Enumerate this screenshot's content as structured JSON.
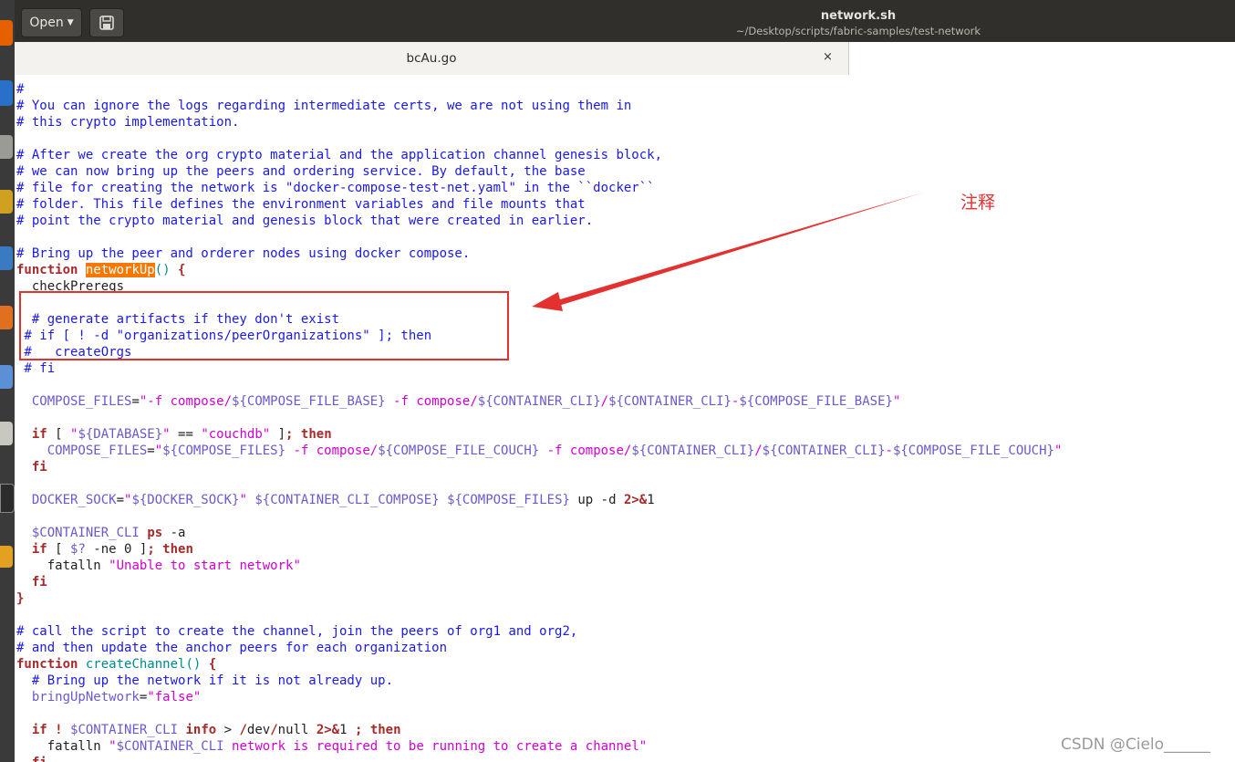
{
  "window": {
    "open_label": "Open",
    "title": "network.sh",
    "subtitle": "~/Desktop/scripts/fabric-samples/test-network"
  },
  "tab": {
    "label": "bcAu.go",
    "close": "×"
  },
  "colors": {
    "comment": "#1a1ae5",
    "keyword": "#a52a2a",
    "function_name": "#008a8c",
    "string": "#d000d0",
    "variable": "#6a5acd",
    "highlight": "#f57900",
    "annotation": "#e53030"
  },
  "code_lines": [
    [
      [
        "cm",
        "#"
      ]
    ],
    [
      [
        "cm",
        "# You can ignore the logs regarding intermediate certs, we are not using them in"
      ]
    ],
    [
      [
        "cm",
        "# this crypto implementation."
      ]
    ],
    [],
    [
      [
        "cm",
        "# After we create the org crypto material and the application channel genesis block,"
      ]
    ],
    [
      [
        "cm",
        "# we can now bring up the peers and ordering service. By default, the base"
      ]
    ],
    [
      [
        "cm",
        "# file for creating the network is \"docker-compose-test-net.yaml\" in the ``docker``"
      ]
    ],
    [
      [
        "cm",
        "# folder. This file defines the environment variables and file mounts that"
      ]
    ],
    [
      [
        "cm",
        "# point the crypto material and genesis block that were created in earlier."
      ]
    ],
    [],
    [
      [
        "cm",
        "# Bring up the peer and orderer nodes using docker compose."
      ]
    ],
    [
      [
        "kw",
        "function"
      ],
      [
        "pl",
        " "
      ],
      [
        "hl",
        "networkUp"
      ],
      [
        "fn",
        "()"
      ],
      [
        "pl",
        " "
      ],
      [
        "kw",
        "{"
      ]
    ],
    [
      [
        "pl",
        "  checkPrereqs"
      ]
    ],
    [],
    [
      [
        "cm",
        "  # generate artifacts if they don't exist"
      ]
    ],
    [
      [
        "cm",
        " # if [ ! -d \"organizations/peerOrganizations\" ]; then"
      ]
    ],
    [
      [
        "cm",
        " #   createOrgs"
      ]
    ],
    [
      [
        "cm",
        " # fi"
      ]
    ],
    [],
    [
      [
        "pl",
        "  "
      ],
      [
        "vr",
        "COMPOSE_FILES"
      ],
      [
        "pl",
        "="
      ],
      [
        "st",
        "\"-f compose/"
      ],
      [
        "vr",
        "${COMPOSE_FILE_BASE}"
      ],
      [
        "st",
        " -f compose/"
      ],
      [
        "vr",
        "${CONTAINER_CLI}"
      ],
      [
        "st",
        "/"
      ],
      [
        "vr",
        "${CONTAINER_CLI}"
      ],
      [
        "st",
        "-"
      ],
      [
        "vr",
        "${COMPOSE_FILE_BASE}"
      ],
      [
        "st",
        "\""
      ]
    ],
    [],
    [
      [
        "pl",
        "  "
      ],
      [
        "kw",
        "if"
      ],
      [
        "pl",
        " [ "
      ],
      [
        "st",
        "\""
      ],
      [
        "vr",
        "${DATABASE}"
      ],
      [
        "st",
        "\""
      ],
      [
        "pl",
        " == "
      ],
      [
        "st",
        "\"couchdb\""
      ],
      [
        "pl",
        " ]"
      ],
      [
        "kw",
        "; then"
      ]
    ],
    [
      [
        "pl",
        "    "
      ],
      [
        "vr",
        "COMPOSE_FILES"
      ],
      [
        "pl",
        "="
      ],
      [
        "st",
        "\""
      ],
      [
        "vr",
        "${COMPOSE_FILES}"
      ],
      [
        "st",
        " -f compose/"
      ],
      [
        "vr",
        "${COMPOSE_FILE_COUCH}"
      ],
      [
        "st",
        " -f compose/"
      ],
      [
        "vr",
        "${CONTAINER_CLI}"
      ],
      [
        "st",
        "/"
      ],
      [
        "vr",
        "${CONTAINER_CLI}"
      ],
      [
        "st",
        "-"
      ],
      [
        "vr",
        "${COMPOSE_FILE_COUCH}"
      ],
      [
        "st",
        "\""
      ]
    ],
    [
      [
        "pl",
        "  "
      ],
      [
        "kw",
        "fi"
      ]
    ],
    [],
    [
      [
        "pl",
        "  "
      ],
      [
        "vr",
        "DOCKER_SOCK"
      ],
      [
        "pl",
        "="
      ],
      [
        "st",
        "\""
      ],
      [
        "vr",
        "${DOCKER_SOCK}"
      ],
      [
        "st",
        "\""
      ],
      [
        "pl",
        " "
      ],
      [
        "vr",
        "${CONTAINER_CLI_COMPOSE}"
      ],
      [
        "pl",
        " "
      ],
      [
        "vr",
        "${COMPOSE_FILES}"
      ],
      [
        "pl",
        " up -d "
      ],
      [
        "kw",
        "2>&"
      ],
      [
        "pl",
        "1"
      ]
    ],
    [],
    [
      [
        "pl",
        "  "
      ],
      [
        "vr",
        "$CONTAINER_CLI"
      ],
      [
        "pl",
        " "
      ],
      [
        "kw",
        "ps"
      ],
      [
        "pl",
        " -a"
      ]
    ],
    [
      [
        "pl",
        "  "
      ],
      [
        "kw",
        "if"
      ],
      [
        "pl",
        " [ "
      ],
      [
        "vr",
        "$?"
      ],
      [
        "pl",
        " -ne 0 ]"
      ],
      [
        "kw",
        "; then"
      ]
    ],
    [
      [
        "pl",
        "    fatalln "
      ],
      [
        "st",
        "\"Unable to start network\""
      ]
    ],
    [
      [
        "pl",
        "  "
      ],
      [
        "kw",
        "fi"
      ]
    ],
    [
      [
        "kw",
        "}"
      ]
    ],
    [],
    [
      [
        "cm",
        "# call the script to create the channel, join the peers of org1 and org2,"
      ]
    ],
    [
      [
        "cm",
        "# and then update the anchor peers for each organization"
      ]
    ],
    [
      [
        "kw",
        "function"
      ],
      [
        "pl",
        " "
      ],
      [
        "fn",
        "createChannel()"
      ],
      [
        "pl",
        " "
      ],
      [
        "kw",
        "{"
      ]
    ],
    [
      [
        "cm",
        "  # Bring up the network if it is not already up."
      ]
    ],
    [
      [
        "pl",
        "  "
      ],
      [
        "vr",
        "bringUpNetwork"
      ],
      [
        "pl",
        "="
      ],
      [
        "st",
        "\"false\""
      ]
    ],
    [],
    [
      [
        "pl",
        "  "
      ],
      [
        "kw",
        "if !"
      ],
      [
        "pl",
        " "
      ],
      [
        "vr",
        "$CONTAINER_CLI"
      ],
      [
        "pl",
        " "
      ],
      [
        "kw",
        "info"
      ],
      [
        "pl",
        " > "
      ],
      [
        "kw",
        "/"
      ],
      [
        "pl",
        "dev"
      ],
      [
        "kw",
        "/"
      ],
      [
        "pl",
        "null "
      ],
      [
        "kw",
        "2>&"
      ],
      [
        "pl",
        "1 "
      ],
      [
        "kw",
        "; then"
      ]
    ],
    [
      [
        "pl",
        "    fatalln "
      ],
      [
        "st",
        "\""
      ],
      [
        "vr",
        "$CONTAINER_CLI"
      ],
      [
        "st",
        " network is required to be running to create a channel\""
      ]
    ],
    [
      [
        "pl",
        "  "
      ],
      [
        "kw",
        "fi"
      ]
    ]
  ],
  "annotation": {
    "label": "注释"
  },
  "watermark": "CSDN @Cielo______"
}
